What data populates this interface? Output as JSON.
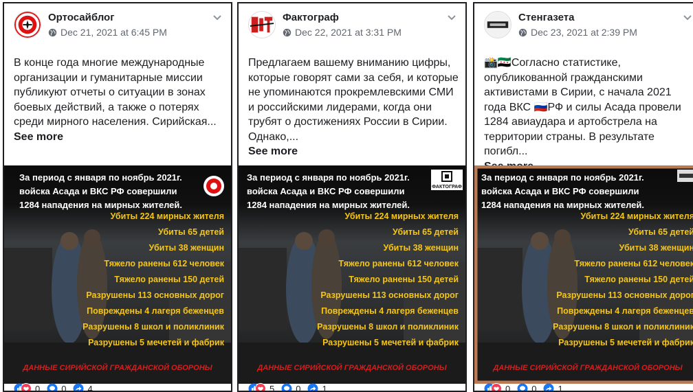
{
  "colors": {
    "stat_yellow": "#f5c518",
    "source_red": "#d21f1f",
    "meta_grey": "#606770",
    "text_dark": "#1c1e21",
    "facebook_blue": "#1877f2",
    "frame_brown": "#b97a54"
  },
  "infographic": {
    "headline": [
      "За период с января по ноябрь 2021г.",
      "войска Асада и ВКС РФ совершили",
      "1284 нападения на мирных жителей."
    ],
    "stats": [
      "Убиты 224 мирных жителя",
      "Убиты 65 детей",
      "Убиты 38 женщин",
      "Тяжело ранены 612 человек",
      "Тяжело ранены 150 детей",
      "Разрушены 113 основных дорог",
      "Повреждены 4 лагеря беженцев",
      "Разрушены 8 школ и поликлиник",
      "Разрушены 5 мечетей и фабрик"
    ],
    "source": "ДАННЫЕ СИРИЙСКОЙ ГРАЖДАНСКОЙ ОБОРОНЫ",
    "watermark_faktograf": "ФАКТОГРАФ"
  },
  "posts": [
    {
      "page_name": "Ортосайблог",
      "date": "Dec 21, 2021 at 6:45 PM",
      "text": "В конце года многие международные организации и гуманитарные миссии публикуют отчеты о ситуации в зонах боевых действий, а также о потерях среди мирного населения. Сирийская...",
      "see_more": "See more",
      "reactions": "0",
      "comments": "0",
      "shares": "4",
      "avatar_icon": "ortosaiblog-logo-icon"
    },
    {
      "page_name": "Фактограф",
      "date": "Dec 22, 2021 at 3:31 PM",
      "text": "Предлагаем вашему вниманию цифры, которые говорят сами за себя, и которые не упоминаются прокремлевскими СМИ и российскими лидерами, когда они трубят о достижениях России в Сирии. Однако,...",
      "see_more": "See more",
      "reactions": "5",
      "comments": "0",
      "shares": "1",
      "avatar_icon": "faktograf-logo-icon"
    },
    {
      "page_name": "Стенгазета",
      "date": "Dec 23, 2021 at 2:39 PM",
      "text": "📸🇸🇾Согласно статистике, опубликованной гражданскими активистами в Сирии, с начала 2021 года ВКС 🇷🇺РФ и силы Асада провели 1284 авиаудара и артобстрела на территории страны. В результате погибл...",
      "see_more": "See more",
      "reactions": "0",
      "comments": "0",
      "shares": "1",
      "avatar_icon": "stengazeta-logo-icon"
    }
  ]
}
